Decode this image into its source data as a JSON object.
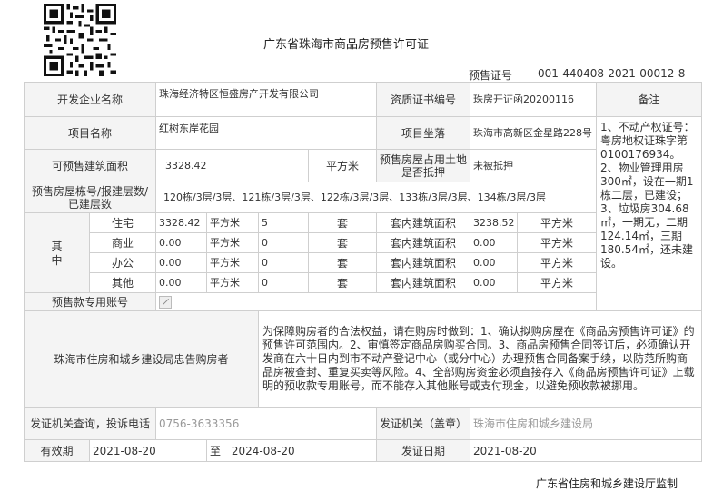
{
  "header": {
    "title": "广东省珠海市商品房预售许可证",
    "cert_no_label": "预售证号",
    "cert_no": "001-440408-2021-00012-8",
    "qr_icon": "qr-code-icon"
  },
  "row1": {
    "developer_label": "开发企业名称",
    "developer": "珠海经济特区恒盛房产开发有限公司",
    "qual_label": "资质证书编号",
    "qual_value": "珠房开证函20200116",
    "remark_label": "备注"
  },
  "row2": {
    "project_label": "项目名称",
    "project": "红树东岸花园",
    "location_label": "项目坐落",
    "location": "珠海市高新区金星路228号"
  },
  "row3": {
    "area_label": "可预售建筑面积",
    "area_value": "3328.42",
    "area_unit": "平方米",
    "land_label": "预售房屋占用土地是否抵押",
    "land_value": "未被抵押"
  },
  "row4": {
    "buildings_label": "预售房屋栋号/报建层数/已建层数",
    "buildings_value": "120栋/3层/3层、121栋/3层/3层、122栋/3层/3层、133栋/3层/3层、134栋/3层/3层"
  },
  "breakdown": {
    "group_label": "其中",
    "unit_sqm": "平方米",
    "unit_set": "套",
    "inner_label": "套内建筑面积",
    "rows": [
      {
        "type": "住宅",
        "area": "3328.42",
        "count": "5",
        "inner": "3238.52"
      },
      {
        "type": "商业",
        "area": "0.00",
        "count": "0",
        "inner": "0.00"
      },
      {
        "type": "办公",
        "area": "0.00",
        "count": "0",
        "inner": "0.00"
      },
      {
        "type": "其他",
        "area": "0.00",
        "count": "0",
        "inner": "0.00"
      }
    ]
  },
  "account": {
    "label": "预售款专用账号",
    "icon": "edit-icon"
  },
  "notice": {
    "label": "珠海市住房和城乡建设局忠告购房者",
    "text": "为保障购房者的合法权益，请在购房时做到：1、确认拟购房屋在《商品房预售许可证》的预售许可范围内。2、审慎签定商品房购买合同。3、商品房预售合同签订后，必须确认开发商在六十日内到市不动产登记中心（或分中心）办理预售合同备案手续，以防范所购商品房被查封、重复买卖等风险。4、全部购房资金必须直接存入《商品房预售许可证》上载明的预收款专用账号，而不能存入其他账号或支付现金，以避免预收款被挪用。"
  },
  "remark": {
    "text": "1、不动产权证号：粤房地权证珠字第0100176934。2、物业管理用房300㎡，设在一期1栋二层，已建设；3、垃圾房304.68㎡，一期无，二期124.14㎡，三期180.54㎡，还未建设。"
  },
  "issue": {
    "phone_label": "发证机关查询，投诉电话",
    "phone": "0756-3633356",
    "authority_label": "发证机关（盖章）",
    "authority": "珠海市住房和城乡建设局"
  },
  "validity": {
    "label": "有效期",
    "from": "2021-08-20",
    "to_label": "至",
    "to": "2024-08-20",
    "issue_date_label": "发证日期",
    "issue_date": "2021-08-20"
  },
  "footer": {
    "text": "广东省住房和城乡建设厅监制"
  }
}
